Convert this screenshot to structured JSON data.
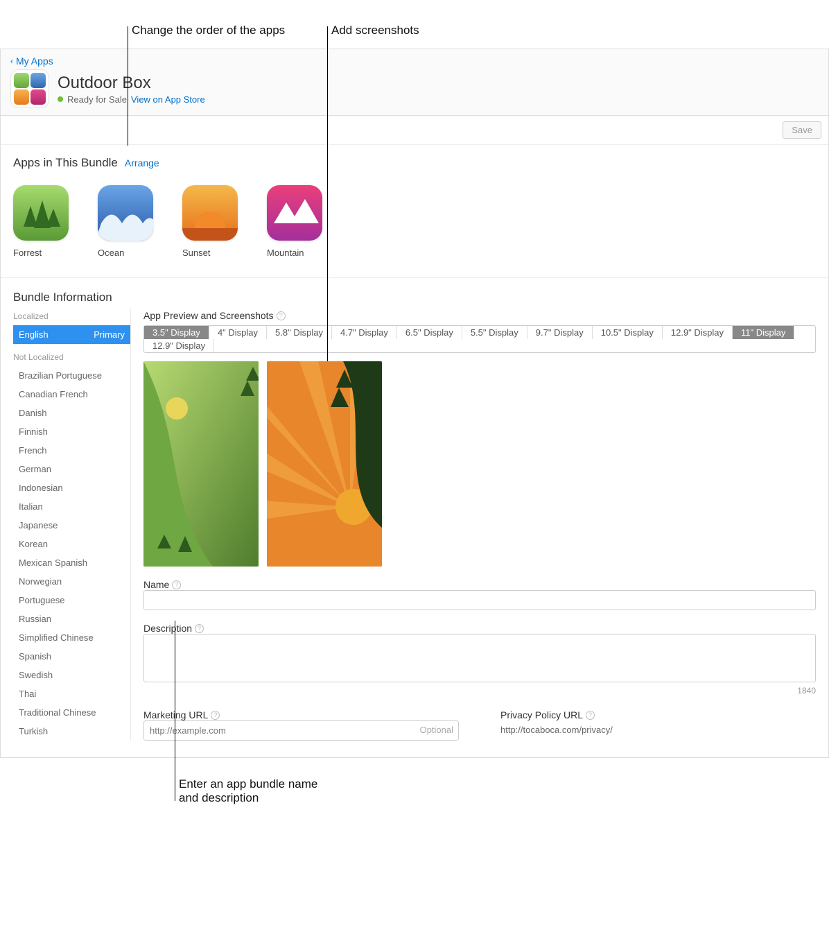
{
  "callouts": {
    "order": "Change the order of the apps",
    "screenshots": "Add screenshots",
    "bottom_l1": "Enter an app bundle name",
    "bottom_l2": "and description"
  },
  "header": {
    "back": "My Apps",
    "title": "Outdoor Box",
    "status": "Ready for Sale",
    "view_link": "View on App Store"
  },
  "save": "Save",
  "bundle_section": {
    "title": "Apps in This Bundle",
    "arrange": "Arrange",
    "apps": [
      {
        "name": "Forrest"
      },
      {
        "name": "Ocean"
      },
      {
        "name": "Sunset"
      },
      {
        "name": "Mountain"
      }
    ]
  },
  "info": {
    "title": "Bundle Information",
    "localized": "Localized",
    "not_localized": "Not Localized",
    "active_lang": "English",
    "primary": "Primary",
    "langs": [
      "Brazilian Portuguese",
      "Canadian French",
      "Danish",
      "Finnish",
      "French",
      "German",
      "Indonesian",
      "Italian",
      "Japanese",
      "Korean",
      "Mexican Spanish",
      "Norwegian",
      "Portuguese",
      "Russian",
      "Simplified Chinese",
      "Spanish",
      "Swedish",
      "Thai",
      "Traditional Chinese",
      "Turkish"
    ],
    "preview_label": "App Preview and Screenshots",
    "display_sizes": [
      "3.5\" Display",
      "4\" Display",
      "5.8\" Display",
      "4.7\" Display",
      "6.5\" Display",
      "5.5\" Display",
      "9.7\" Display",
      "10.5\" Display",
      "12.9\" Display",
      "11\" Display",
      "12.9\" Display"
    ],
    "name_label": "Name",
    "desc_label": "Description",
    "char_count": "1840",
    "marketing_label": "Marketing URL",
    "marketing_placeholder": "http://example.com",
    "optional": "Optional",
    "privacy_label": "Privacy Policy URL",
    "privacy_url": "http://tocaboca.com/privacy/"
  }
}
